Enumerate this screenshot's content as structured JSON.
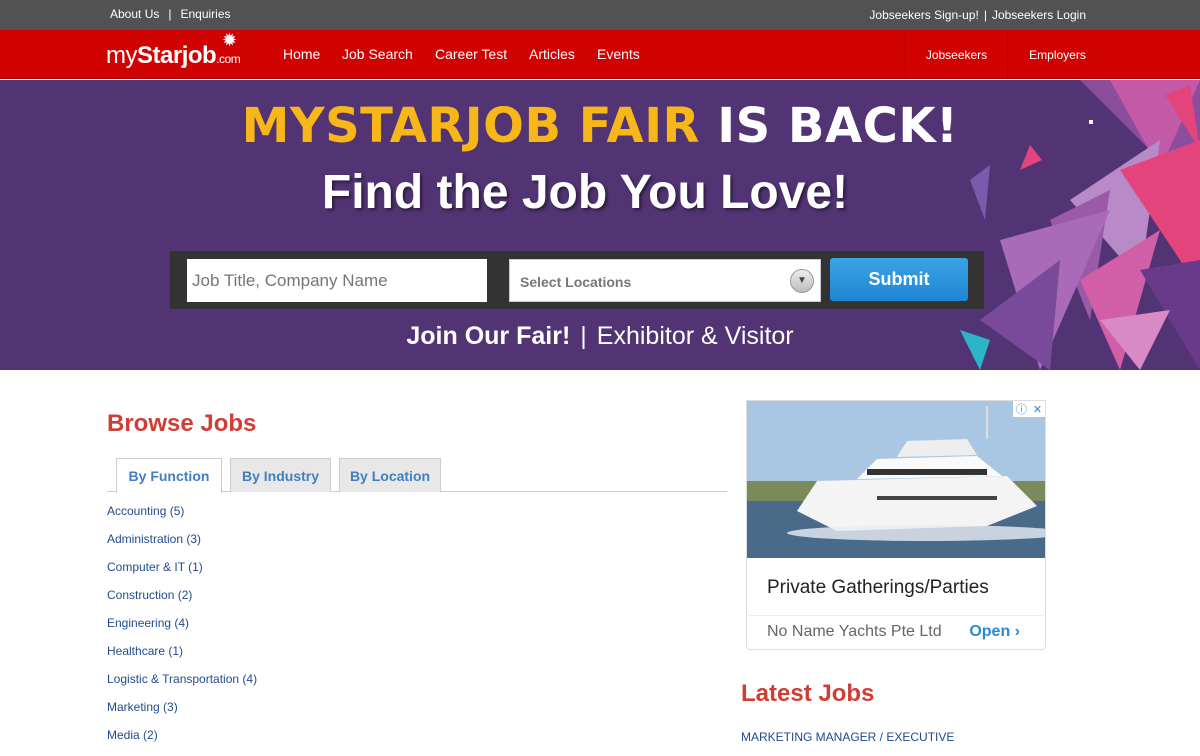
{
  "topbar": {
    "about": "About Us",
    "sep": "|",
    "enquiries": "Enquiries",
    "signup": "Jobseekers Sign-up!",
    "login": "Jobseekers Login"
  },
  "nav": {
    "logo_my": "my",
    "logo_star": "Starjob",
    "logo_dot": ".com",
    "links": [
      "Home",
      "Job Search",
      "Career Test",
      "Articles",
      "Events"
    ],
    "jobseekers": "Jobseekers",
    "employers": "Employers"
  },
  "hero": {
    "title_yellow": "MYSTARJOB FAIR",
    "title_white": "IS BACK!",
    "subtitle": "Find the Job You Love!",
    "job_placeholder": "Job Title, Company Name",
    "location_placeholder": "Select Locations",
    "submit": "Submit",
    "join": "Join Our Fair!",
    "bar": "|",
    "join_rest": "Exhibitor & Visitor",
    "colors": {
      "background": "#523474",
      "accent_yellow": "#f7b718",
      "accent_pink": "#e3447c"
    }
  },
  "browse": {
    "title": "Browse Jobs",
    "tabs": [
      "By Function",
      "By Industry",
      "By Location"
    ],
    "active_tab": "By Function",
    "items": [
      "Accounting (5)",
      "Administration (3)",
      "Computer & IT (1)",
      "Construction (2)",
      "Engineering (4)",
      "Healthcare (1)",
      "Logistic & Transportation (4)",
      "Marketing (3)",
      "Media (2)"
    ]
  },
  "ad": {
    "headline": "Private Gatherings/Parties",
    "advertiser": "No Name Yachts Pte Ltd",
    "cta": "Open",
    "cta_icon": "chevron-right-icon"
  },
  "latest": {
    "title": "Latest Jobs",
    "items": [
      "MARKETING MANAGER / EXECUTIVE"
    ]
  },
  "brand_color": "#d10202"
}
